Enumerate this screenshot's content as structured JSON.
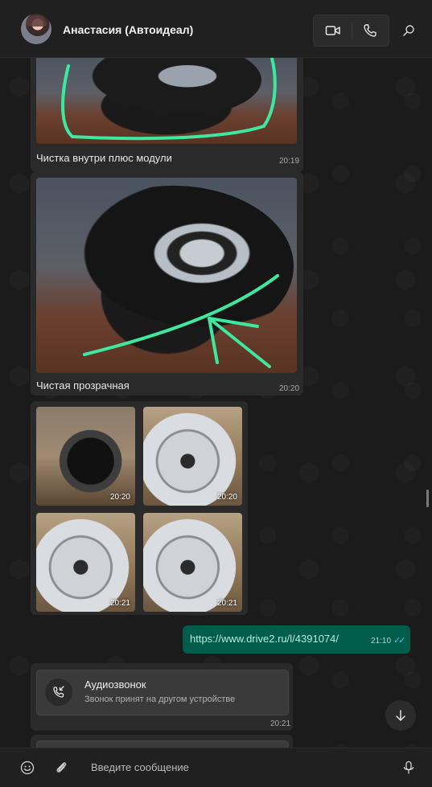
{
  "header": {
    "contact_name": "Анастасия (Автоидеал)",
    "icons": [
      "avatar",
      "video-call-icon",
      "phone-icon",
      "search-icon"
    ]
  },
  "messages": {
    "photo1": {
      "caption": "Чистка внутри плюс модули",
      "time": "20:19"
    },
    "photo2": {
      "caption": "Чистая прозрачная",
      "time": "20:20"
    },
    "album": {
      "items": [
        {
          "time": "20:20"
        },
        {
          "time": "20:20"
        },
        {
          "time": "20:21"
        },
        {
          "time": "20:21"
        }
      ]
    },
    "outgoing_link": {
      "text": "https://www.drive2.ru/l/4391074/",
      "time": "21:10",
      "status": "read"
    },
    "call": {
      "title": "Аудиозвонок",
      "subtitle": "Звонок принят на другом устройстве",
      "time": "20:21"
    }
  },
  "composer": {
    "placeholder": "Введите сообщение",
    "icons": [
      "emoji-icon",
      "attach-icon",
      "mic-icon"
    ]
  },
  "colors": {
    "background": "#1b1b1b",
    "incoming_bubble": "#2a2a2a",
    "outgoing_bubble": "#005c4b",
    "read_ticks": "#53bdeb",
    "drawn_marker": "#3ee8a0"
  }
}
